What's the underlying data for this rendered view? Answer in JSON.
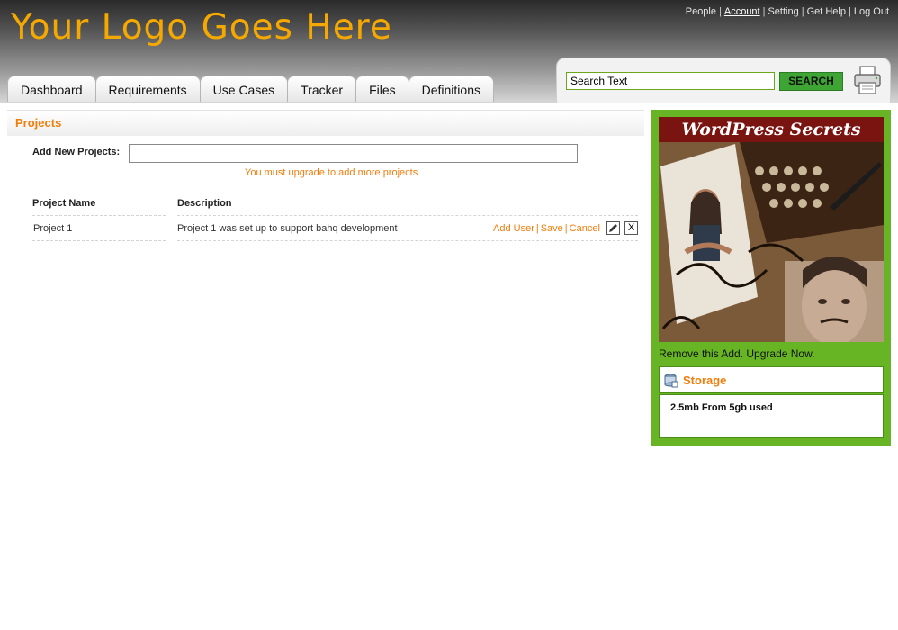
{
  "header": {
    "logo_text": "Your Logo Goes Here",
    "top_links": [
      "People",
      "Account",
      "Setting",
      "Get Help",
      "Log Out"
    ],
    "tabs": [
      "Dashboard",
      "Requirements",
      "Use Cases",
      "Tracker",
      "Files",
      "Definitions"
    ],
    "search": {
      "value": "Search Text",
      "button_label": "SEARCH"
    }
  },
  "main": {
    "section_title": "Projects",
    "add_label": "Add New Projects:",
    "upgrade_message": "You must upgrade to add more projects",
    "columns": [
      "Project Name",
      "Description"
    ],
    "rows": [
      {
        "name": "Project 1",
        "description": "Project 1 was set up to support bahq development",
        "actions": [
          "Add User",
          "Save",
          "Cancel"
        ],
        "delete_glyph": "X"
      }
    ]
  },
  "sidebar": {
    "ad_title": "WordPress Secrets",
    "ad_link": "Remove this Add. Upgrade Now.",
    "storage_title": "Storage",
    "storage_text": "2.5mb From 5gb used"
  },
  "colors": {
    "logo": "#f5a800",
    "accent_orange": "#f07d0a",
    "sidebar_green": "#67b525",
    "search_button": "#3ea534"
  },
  "icons": [
    "print-icon",
    "edit-pencil-icon",
    "delete-icon",
    "storage-icon"
  ]
}
